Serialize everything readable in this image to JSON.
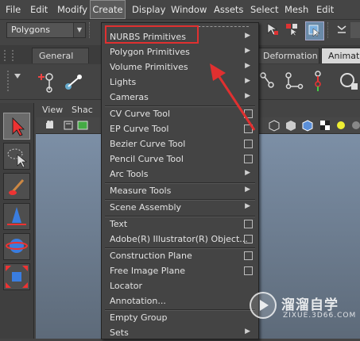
{
  "menubar": {
    "items": [
      "File",
      "Edit",
      "Modify",
      "Create",
      "Display",
      "Window",
      "Assets",
      "Select",
      "Mesh",
      "Edit Mesh"
    ],
    "active": "Create"
  },
  "toolbar": {
    "mode_select": {
      "value": "Polygons"
    }
  },
  "shelf": {
    "tabs": [
      "General",
      "Deformation",
      "Animatio"
    ]
  },
  "panel": {
    "menu": [
      "View",
      "Shac"
    ]
  },
  "create_menu": {
    "items": [
      {
        "label": "NURBS Primitives",
        "submenu": true
      },
      {
        "label": "Polygon Primitives",
        "submenu": true
      },
      {
        "label": "Volume Primitives",
        "submenu": true
      },
      {
        "label": "Lights",
        "submenu": true
      },
      {
        "label": "Cameras",
        "submenu": true
      },
      {
        "label": "CV Curve Tool",
        "option_box": true
      },
      {
        "label": "EP Curve Tool",
        "option_box": true
      },
      {
        "label": "Bezier Curve Tool",
        "option_box": true
      },
      {
        "label": "Pencil Curve Tool",
        "option_box": true
      },
      {
        "label": "Arc Tools",
        "submenu": true
      },
      {
        "label": "Measure Tools",
        "submenu": true
      },
      {
        "label": "Scene Assembly",
        "submenu": true
      },
      {
        "label": "Text",
        "option_box": true
      },
      {
        "label": "Adobe(R) Illustrator(R) Object...",
        "option_box": true
      },
      {
        "label": "Construction Plane",
        "option_box": true
      },
      {
        "label": "Free Image Plane",
        "option_box": true
      },
      {
        "label": "Locator"
      },
      {
        "label": "Annotation..."
      },
      {
        "label": "Empty Group"
      },
      {
        "label": "Sets",
        "submenu": true
      }
    ],
    "highlighted": "NURBS Primitives"
  },
  "annotation": {
    "highlight_color": "#e03030"
  },
  "watermark": {
    "title": "溜溜自学",
    "url": "ZIXUE.3D66.COM"
  },
  "colors": {
    "menu_bg": "#444444",
    "viewport_top": "#7c8fa6",
    "viewport_bottom": "#5d6a79"
  }
}
